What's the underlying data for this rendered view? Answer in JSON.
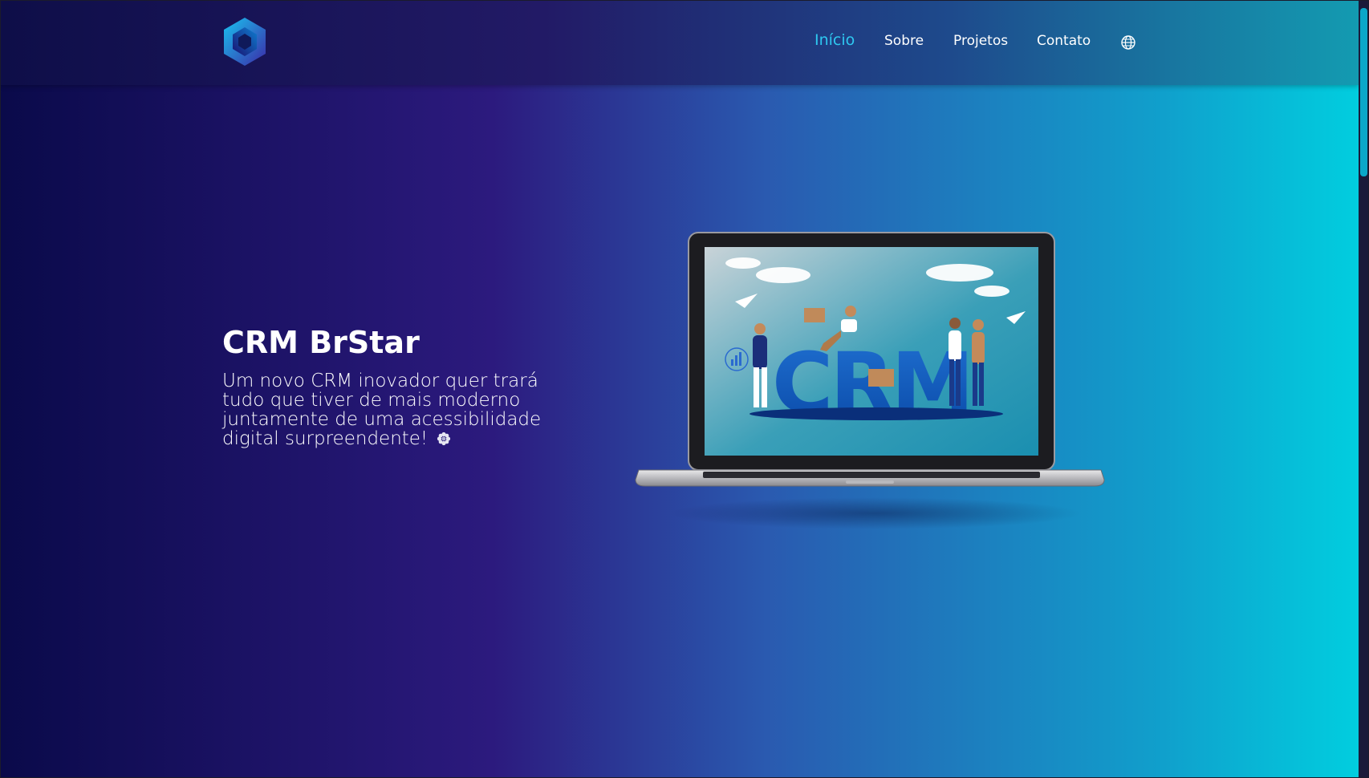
{
  "navbar": {
    "logo_text": "",
    "items": [
      {
        "label": "Início",
        "active": true
      },
      {
        "label": "Sobre",
        "active": false
      },
      {
        "label": "Projetos",
        "active": false
      },
      {
        "label": "Contato",
        "active": false
      }
    ],
    "globe_icon": "globe-icon"
  },
  "hero": {
    "title": "CRM BrStar",
    "description_lines": [
      "Um novo CRM inovador quer trará",
      "tudo que tiver de mais moderno",
      "juntamente de uma acessibilidade",
      "digital surpreendente!"
    ],
    "emoji_icon": "flower-icon",
    "image_label": "CRM"
  },
  "colors": {
    "accent": "#2ec8f0",
    "gradient_start": "#0a0a4a",
    "gradient_end": "#00d0e0"
  }
}
